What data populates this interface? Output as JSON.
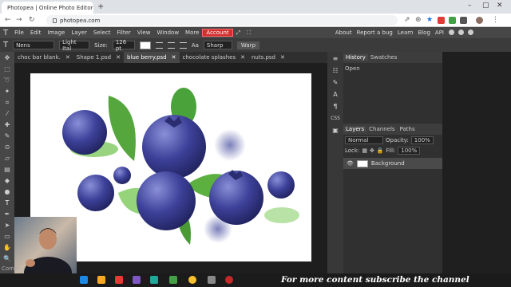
{
  "browser": {
    "tab_title": "Photopea | Online Photo Editor",
    "url": "photopea.com"
  },
  "menu": {
    "items": [
      "File",
      "Edit",
      "Image",
      "Layer",
      "Select",
      "Filter",
      "View",
      "Window",
      "More"
    ],
    "account": "Account",
    "right": [
      "About",
      "Report a bug",
      "Learn",
      "Blog",
      "API"
    ]
  },
  "options": {
    "font": "Nens",
    "style": "Light Ital",
    "size_label": "Size:",
    "size": "126 pt",
    "aa_label": "Aa",
    "aa": "Sharp",
    "warp": "Warp"
  },
  "doc_tabs": [
    "choc bar blank.",
    "Shape 1.psd",
    "blue berry.psd",
    "chocolate splashes",
    "nuts.psd"
  ],
  "active_doc": "blue berry.psd",
  "history": {
    "tabs": [
      "History",
      "Swatches"
    ],
    "items": [
      "Open"
    ]
  },
  "layers": {
    "tabs": [
      "Layers",
      "Channels",
      "Paths"
    ],
    "blend": "Normal",
    "opacity_label": "Opacity:",
    "opacity": "100%",
    "lock_label": "Lock:",
    "fill_label": "Fill:",
    "fill": "100%",
    "items": [
      "Background"
    ]
  },
  "status_text": "Comm",
  "promo": "For more content subscribe the channel",
  "colors": {
    "accent": "#d32f2f",
    "berry": "#3b3f8f",
    "leaf": "#4a9a3a"
  }
}
